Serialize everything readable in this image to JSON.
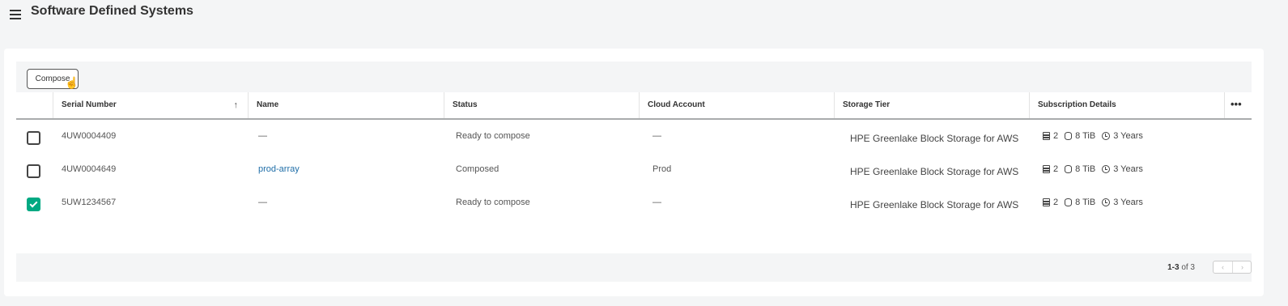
{
  "header": {
    "title": "Software Defined Systems"
  },
  "toolbar": {
    "compose_label": "Compose"
  },
  "table": {
    "columns": [
      "Serial Number",
      "Name",
      "Status",
      "Cloud Account",
      "Storage Tier",
      "Subscription Details"
    ],
    "more_label": "•••",
    "rows": [
      {
        "serial": "4UW0004409",
        "name": "—",
        "status": "Ready to compose",
        "cloud": "—",
        "tier": "HPE Greenlake Block Storage for AWS",
        "arrays": "2",
        "capacity": "8 TiB",
        "term": "3 Years",
        "checked": false
      },
      {
        "serial": "4UW0004649",
        "name": "prod-array",
        "status": "Composed",
        "cloud": "Prod",
        "tier": "HPE Greenlake Block Storage for AWS",
        "arrays": "2",
        "capacity": "8 TiB",
        "term": "3 Years",
        "checked": false
      },
      {
        "serial": "5UW1234567",
        "name": "—",
        "status": "Ready to compose",
        "cloud": "—",
        "tier": "HPE Greenlake Block Storage for AWS",
        "arrays": "2",
        "capacity": "8 TiB",
        "term": "3 Years",
        "checked": true
      }
    ]
  },
  "pagination": {
    "range": "1-3",
    "of_text": "of 3"
  },
  "colors": {
    "accent": "#01a982",
    "link": "#1f6ea8",
    "background": "#f4f5f6"
  },
  "icons": [
    "menu-icon",
    "sort-ascending-icon",
    "more-icon",
    "array-icon",
    "storage-icon",
    "clock-icon",
    "chevron-left-icon",
    "chevron-right-icon"
  ]
}
